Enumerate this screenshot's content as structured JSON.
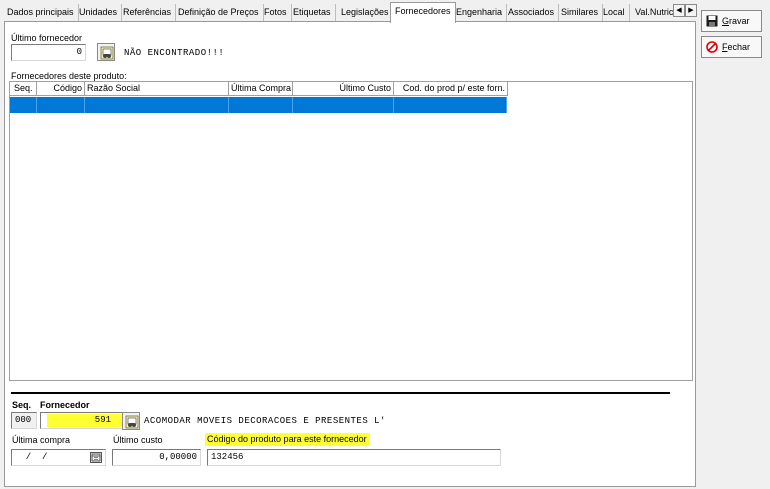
{
  "tabs": [
    {
      "label": "Dados principais",
      "active": false
    },
    {
      "label": "Unidades",
      "active": false
    },
    {
      "label": "Referências",
      "active": false
    },
    {
      "label": "Definição de Preços",
      "active": false
    },
    {
      "label": "Fotos",
      "active": false
    },
    {
      "label": "Etiquetas",
      "active": false
    },
    {
      "label": "Legislações",
      "active": false
    },
    {
      "label": "Fornecedores",
      "active": true
    },
    {
      "label": "Engenharia",
      "active": false
    },
    {
      "label": "Associados",
      "active": false
    },
    {
      "label": "Similares",
      "active": false
    },
    {
      "label": "Local",
      "active": false
    },
    {
      "label": "Val.Nutric",
      "active": false
    }
  ],
  "tab_scroll": {
    "left": "◀",
    "right": "▶"
  },
  "ultimo_fornecedor": {
    "label": "Último fornecedor",
    "value": "0",
    "status": "NÃO ENCONTRADO!!!"
  },
  "grid": {
    "caption": "Fornecedores deste produto:",
    "columns": [
      "Seq.",
      "Código",
      "Razão Social",
      "Última Compra",
      "Último Custo",
      "Cod. do prod p/ este forn."
    ],
    "rows": [
      [
        "",
        "",
        "",
        "",
        "",
        ""
      ]
    ]
  },
  "form": {
    "seq_label": "Seq.",
    "seq_value": "000",
    "fornecedor_label": "Fornecedor",
    "fornecedor_code": "591",
    "fornecedor_name": "ACOMODAR MOVEIS DECORACOES E PRESENTES L'",
    "ultima_compra_label": "Última compra",
    "ultima_compra_value": "  /  /",
    "ultimo_custo_label": "Último custo",
    "ultimo_custo_value": "0,00000",
    "codigo_produto_label": "Código do produto para este fornecedor",
    "codigo_produto_value": "132456"
  },
  "actions": {
    "gravar": {
      "mnemonic": "G",
      "rest": "ravar"
    },
    "fechar": {
      "mnemonic": "F",
      "rest": "echar"
    }
  },
  "colors": {
    "selection": "#0078d7",
    "highlight": "#ffff33",
    "close_icon": "#e00000"
  },
  "icons": [
    "lookup-binoculars-icon",
    "calendar-icon",
    "floppy-disk-icon",
    "prohibited-icon"
  ]
}
